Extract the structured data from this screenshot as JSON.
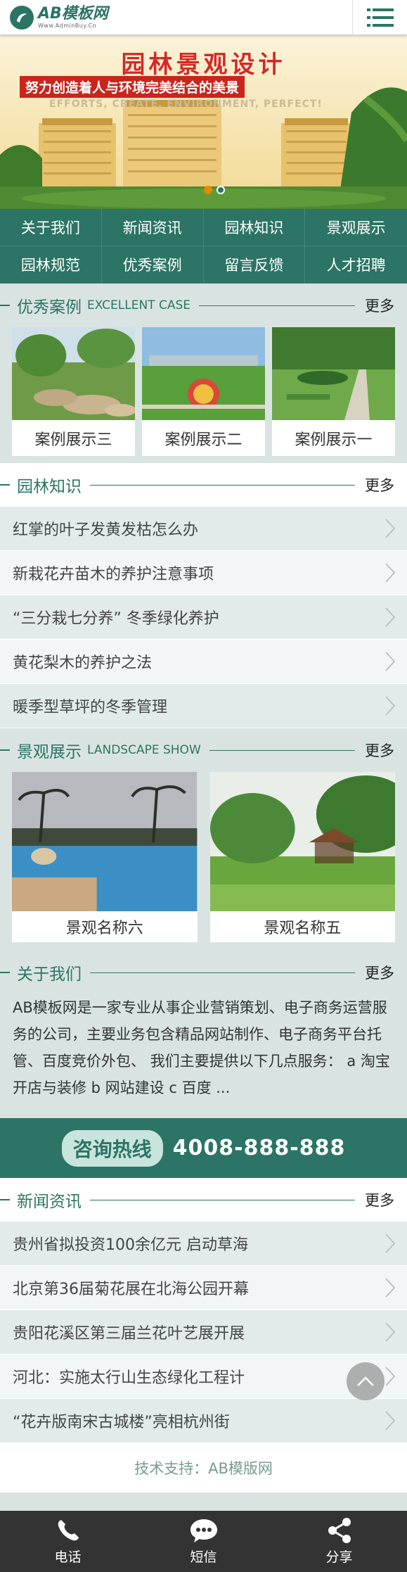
{
  "header": {
    "logo_title": "AB模板网",
    "logo_sub": "Www.AdminBuy.Cn"
  },
  "banner": {
    "title": "园林景观设计",
    "subtitle": "努力创造着人与环境完美结合的美景",
    "english": "EFFORTS, CREATE, ENVIRONMENT, PERFECT!",
    "dots": 2,
    "active_dot": 2
  },
  "nav": [
    "关于我们",
    "新闻资讯",
    "园林知识",
    "景观展示",
    "园林规范",
    "优秀案例",
    "留言反馈",
    "人才招聘"
  ],
  "cases": {
    "title": "优秀案例",
    "en": "EXCELLENT CASE",
    "more": "更多",
    "items": [
      {
        "label": "案例展示三"
      },
      {
        "label": "案例展示二"
      },
      {
        "label": "案例展示一"
      }
    ]
  },
  "knowledge": {
    "title": "园林知识",
    "more": "更多",
    "items": [
      "红掌的叶子发黄发枯怎么办",
      "新栽花卉苗木的养护注意事项",
      "“三分栽七分养” 冬季绿化养护",
      "黄花梨木的养护之法",
      "暖季型草坪的冬季管理"
    ]
  },
  "landscape": {
    "title": "景观展示",
    "en": "LANDSCAPE SHOW",
    "more": "更多",
    "items": [
      {
        "label": "景观名称六"
      },
      {
        "label": "景观名称五"
      }
    ]
  },
  "about": {
    "title": "关于我们",
    "more": "更多",
    "text": "AB模板网是一家专业从事企业营销策划、电子商务运营服务的公司，主要业务包含精品网站制作、电子商务平台托管、百度竞价外包、 我们主要提供以下几点服务： a 淘宝开店与装修 b 网站建设 c 百度 ..."
  },
  "hotline": {
    "label": "咨询热线",
    "number": "4008-888-888"
  },
  "news": {
    "title": "新闻资讯",
    "more": "更多",
    "items": [
      "贵州省拟投资100余亿元 启动草海",
      "北京第36届菊花展在北海公园开幕",
      "贵阳花溪区第三届兰花叶艺展开展",
      "河北：实施太行山生态绿化工程计",
      "“花卉版南宋古城楼”亮相杭州街"
    ]
  },
  "support": "技术支持：AB模版网",
  "footer": {
    "items": [
      {
        "label": "电话",
        "icon": "phone-icon"
      },
      {
        "label": "短信",
        "icon": "sms-icon"
      },
      {
        "label": "分享",
        "icon": "share-icon"
      }
    ]
  },
  "colors": {
    "primary": "#2c7465",
    "background": "#d9e4e2",
    "banner_red": "#c9251c"
  }
}
